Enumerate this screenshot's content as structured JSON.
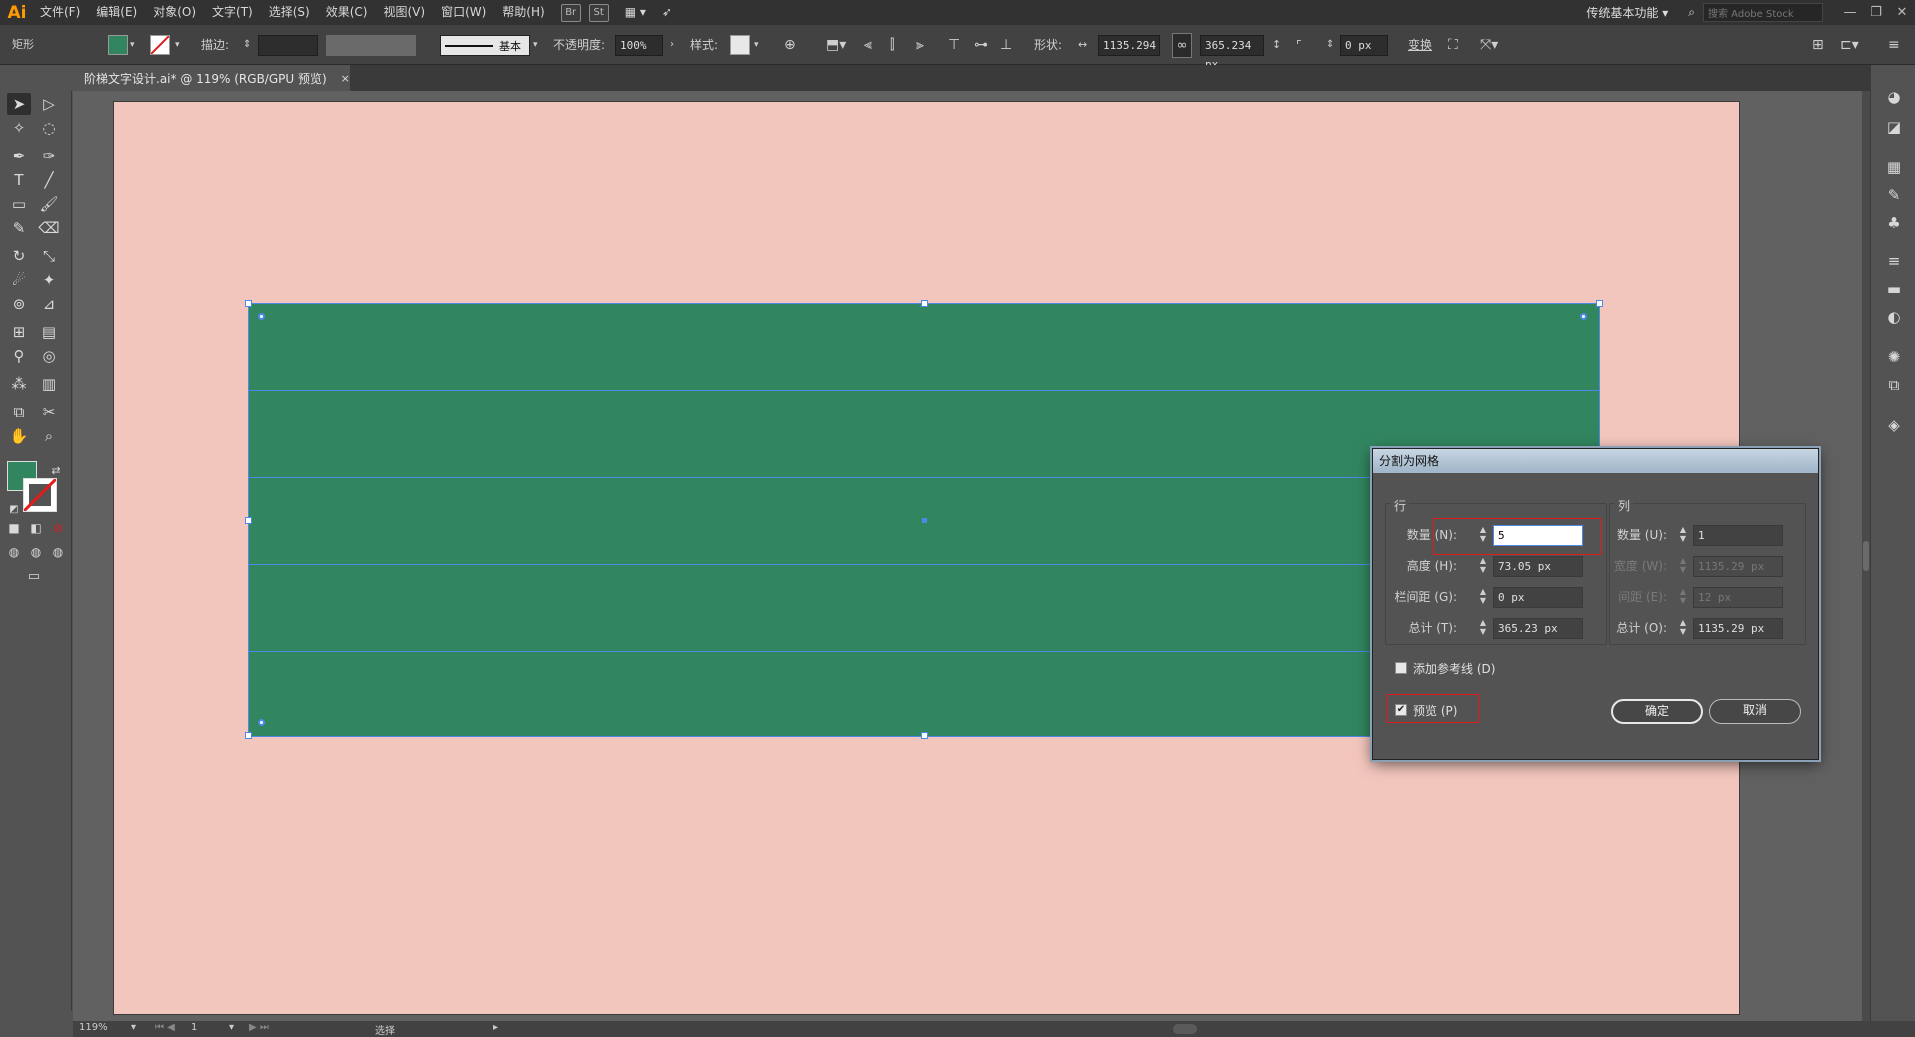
{
  "app": {
    "logo": "Ai"
  },
  "menu": [
    "文件(F)",
    "编辑(E)",
    "对象(O)",
    "文字(T)",
    "选择(S)",
    "效果(C)",
    "视图(V)",
    "窗口(W)",
    "帮助(H)"
  ],
  "menubar_badges": [
    "Br",
    "St"
  ],
  "workspace": "传统基本功能",
  "stock_search_placeholder": "搜索 Adobe Stock",
  "control_bar": {
    "object_type": "矩形",
    "stroke_label": "描边:",
    "stroke_profile": "基本",
    "opacity_label": "不透明度:",
    "opacity_value": "100%",
    "style_label": "样式:",
    "shape_label": "形状:",
    "width_value": "1135.294",
    "height_value": "365.234 px",
    "corner_value": "0 px",
    "transform_label": "变换",
    "fill_color": "#318660"
  },
  "document_tab": {
    "title": "阶梯文字设计.ai* @ 119% (RGB/GPU 预览)",
    "close": "×"
  },
  "canvas": {
    "artboard_color": "#f3c6bd",
    "rect_color": "#318660",
    "grid_rows": 5
  },
  "dialog": {
    "title": "分割为网格",
    "rows_group": "行",
    "cols_group": "列",
    "rows": {
      "count_label": "数量 (N):",
      "count_value": "5",
      "height_label": "高度 (H):",
      "height_value": "73.05 px",
      "gutter_label": "栏间距 (G):",
      "gutter_value": "0 px",
      "total_label": "总计 (T):",
      "total_value": "365.23 px"
    },
    "cols": {
      "count_label": "数量 (U):",
      "count_value": "1",
      "width_label": "宽度 (W):",
      "width_value": "1135.29 px",
      "gutter_label": "间距 (E):",
      "gutter_value": "12 px",
      "total_label": "总计 (O):",
      "total_value": "1135.29 px"
    },
    "add_guides_label": "添加参考线 (D)",
    "add_guides_checked": false,
    "preview_label": "预览 (P)",
    "preview_checked": true,
    "ok_label": "确定",
    "cancel_label": "取消"
  },
  "status": {
    "zoom": "119%",
    "page": "1",
    "tool": "选择"
  }
}
